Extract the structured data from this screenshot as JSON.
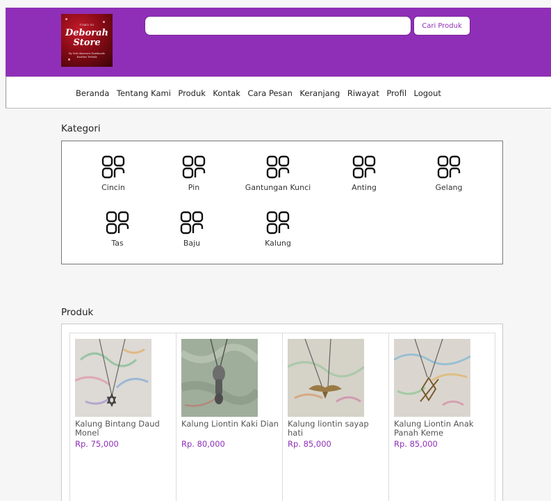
{
  "header": {
    "logo": {
      "top_text": "TOKO DI",
      "brand_line1": "Deborah",
      "brand_line2": "Store",
      "tagline": "By Grid Aksesoris Handmade Kualitas Terbaik"
    },
    "search": {
      "value": "",
      "placeholder": ""
    },
    "search_button_label": "Cari Produk"
  },
  "nav": {
    "items": [
      "Beranda",
      "Tentang Kami",
      "Produk",
      "Kontak",
      "Cara Pesan",
      "Keranjang",
      "Riwayat",
      "Profil",
      "Logout"
    ]
  },
  "kategori": {
    "title": "Kategori",
    "icon": "grid-icon",
    "items": [
      "Cincin",
      "Pin",
      "Gantungan Kunci",
      "Anting",
      "Gelang",
      "Tas",
      "Baju",
      "Kalung"
    ]
  },
  "produk": {
    "title": "Produk",
    "items": [
      {
        "name": "Kalung Bintang Daud Monel",
        "price": "Rp. 75,000"
      },
      {
        "name": "Kalung Liontin Kaki Dian",
        "price": "Rp. 80,000"
      },
      {
        "name": "Kalung liontin sayap hati",
        "price": "Rp. 85,000"
      },
      {
        "name": "Kalung Liontin Anak Panah Keme",
        "price": "Rp. 85,000"
      }
    ]
  },
  "colors": {
    "brand_purple": "#8f2fb7",
    "price_purple": "#8f2fb7",
    "background": "#f6f6f6"
  }
}
